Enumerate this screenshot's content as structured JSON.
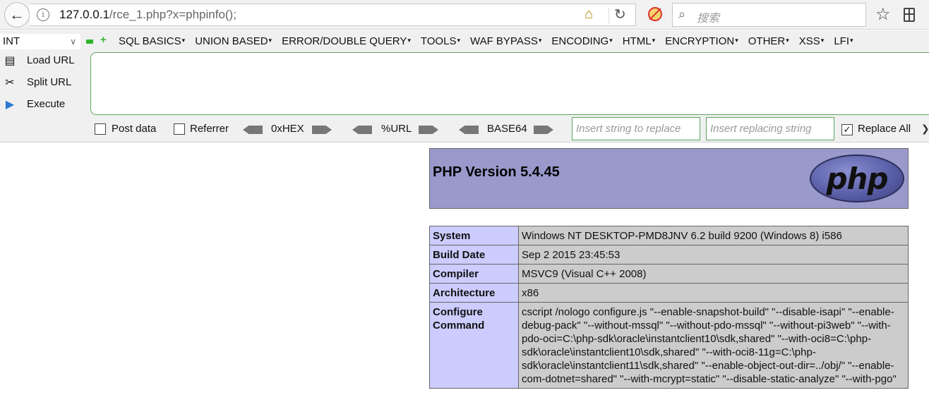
{
  "browser": {
    "url_host": "127.0.0.1",
    "url_path": "/rce_1.php?x=phpinfo();",
    "search_placeholder": "搜索",
    "icons": {
      "back": "back-arrow-icon",
      "info": "info-icon",
      "home": "home-icon",
      "reload": "reload-icon",
      "blocked": "blocked-content-icon",
      "search": "search-icon",
      "bookmark": "star-icon",
      "reader": "reader-view-icon"
    }
  },
  "hackbar": {
    "type_select": "INT",
    "menu": [
      "SQL BASICS",
      "UNION BASED",
      "ERROR/DOUBLE QUERY",
      "TOOLS",
      "WAF BYPASS",
      "ENCODING",
      "HTML",
      "ENCRYPTION",
      "OTHER",
      "XSS",
      "LFI"
    ],
    "load_url": "Load URL",
    "split_url": "Split URL",
    "execute": "Execute",
    "post_data": "Post data",
    "referrer": "Referrer",
    "hex": "0xHEX",
    "url_enc": "%URL",
    "base64": "BASE64",
    "replace_from_placeholder": "Insert string to replace",
    "replace_to_placeholder": "Insert replacing string",
    "replace_all": "Replace All",
    "replace_all_checked": true,
    "post_data_checked": false,
    "referrer_checked": false,
    "accent_color": "#5fa35f"
  },
  "phpinfo": {
    "version": "PHP Version 5.4.45",
    "logo_text": "php",
    "header_color": "#9999cc",
    "key_color": "#ccccff",
    "value_color": "#cccccc",
    "rows": [
      {
        "key": "System",
        "value": "Windows NT DESKTOP-PMD8JNV 6.2 build 9200 (Windows 8) i586"
      },
      {
        "key": "Build Date",
        "value": "Sep 2 2015 23:45:53"
      },
      {
        "key": "Compiler",
        "value": "MSVC9 (Visual C++ 2008)"
      },
      {
        "key": "Architecture",
        "value": "x86"
      },
      {
        "key": "Configure Command",
        "value": "cscript /nologo configure.js \"--enable-snapshot-build\" \"--disable-isapi\" \"--enable-debug-pack\" \"--without-mssql\" \"--without-pdo-mssql\" \"--without-pi3web\" \"--with-pdo-oci=C:\\php-sdk\\oracle\\instantclient10\\sdk,shared\" \"--with-oci8=C:\\php-sdk\\oracle\\instantclient10\\sdk,shared\" \"--with-oci8-11g=C:\\php-sdk\\oracle\\instantclient11\\sdk,shared\" \"--enable-object-out-dir=../obj/\" \"--enable-com-dotnet=shared\" \"--with-mcrypt=static\" \"--disable-static-analyze\" \"--with-pgo\""
      }
    ]
  }
}
